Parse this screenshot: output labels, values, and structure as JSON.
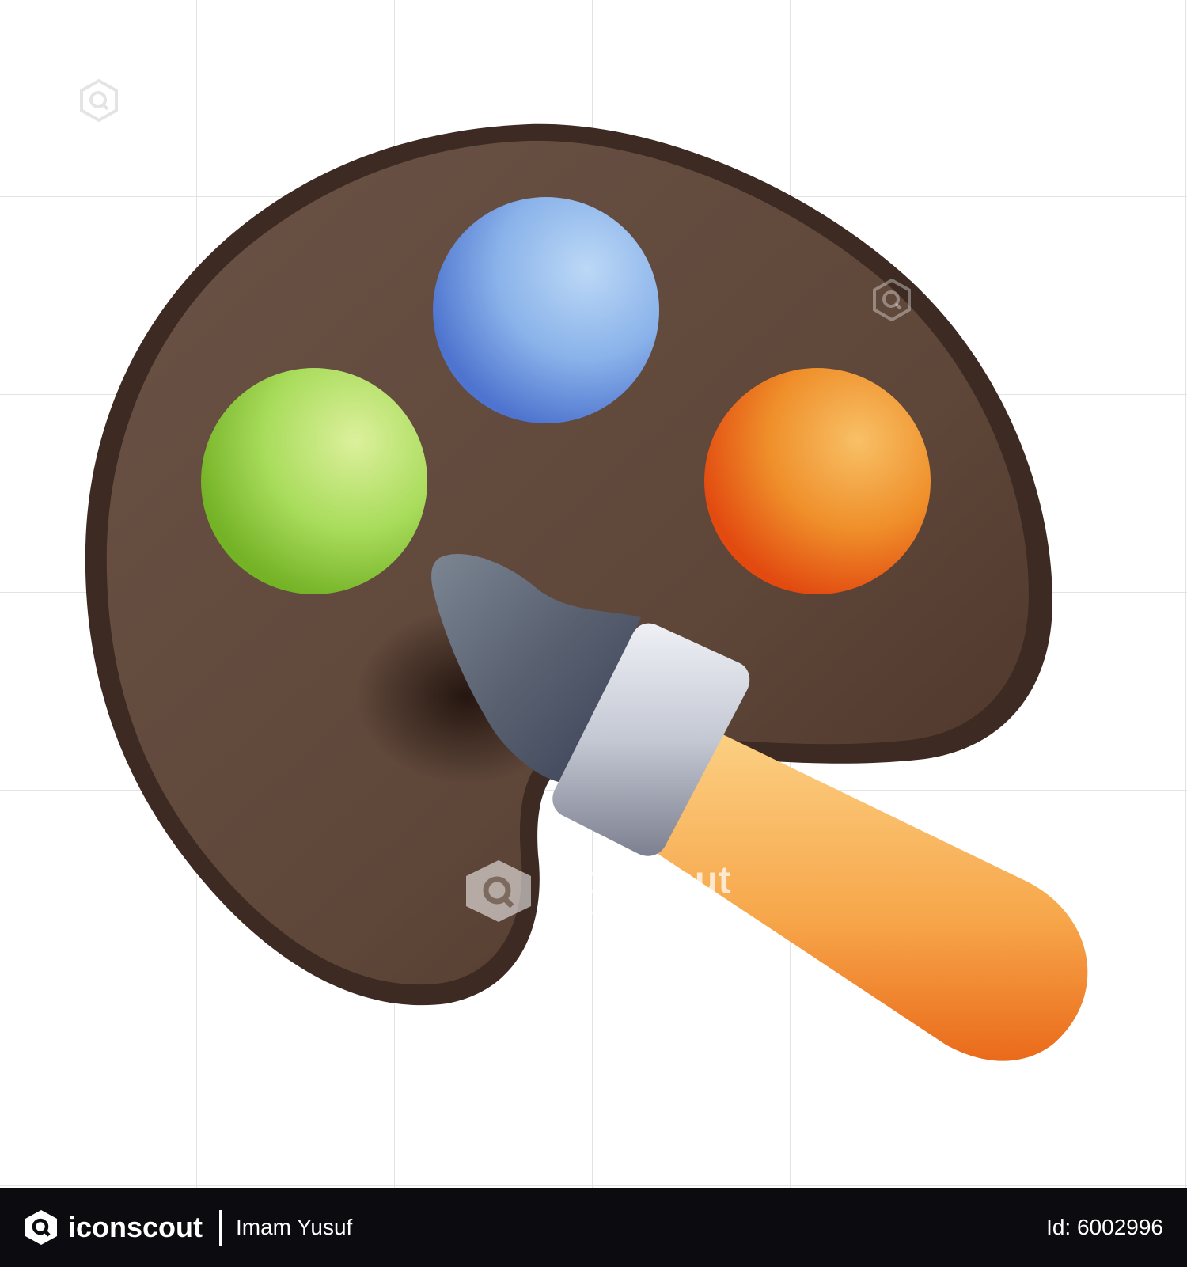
{
  "illustration": {
    "subject": "palette-with-paintbrush-icon",
    "colors": {
      "palette": "#5e4639",
      "paint_blue": "#8fb6ea",
      "paint_green": "#a8dc5c",
      "paint_orange": "#f0902a",
      "brush_tip": "#555c6c",
      "ferrule": "#c8ccd6",
      "handle": "#fbb558"
    }
  },
  "watermark": {
    "brand": "iconscout",
    "author": "Imam Yusuf"
  },
  "footer": {
    "brand": "iconscout",
    "author": "Imam Yusuf",
    "asset_id": "Id: 6002996",
    "background": "#0b0b10"
  }
}
